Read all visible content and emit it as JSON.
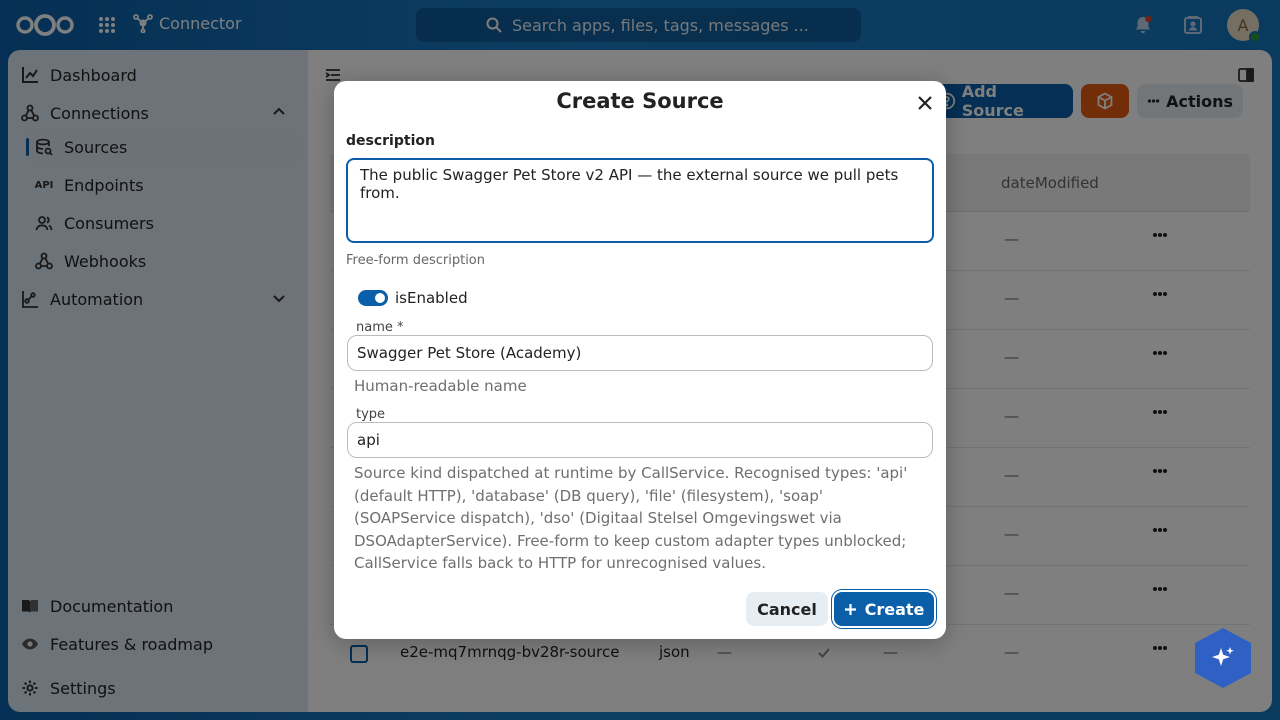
{
  "header": {
    "app_name": "Connector",
    "search_placeholder": "Search apps, files, tags, messages ...",
    "avatar_initial": "A"
  },
  "sidebar": {
    "items": [
      {
        "label": "Dashboard",
        "icon": "dashboard-icon"
      },
      {
        "label": "Connections",
        "icon": "connections-icon"
      },
      {
        "label": "Sources",
        "icon": "sources-icon"
      },
      {
        "label": "Endpoints",
        "icon": "api-icon"
      },
      {
        "label": "Consumers",
        "icon": "consumers-icon"
      },
      {
        "label": "Webhooks",
        "icon": "webhooks-icon"
      },
      {
        "label": "Automation",
        "icon": "automation-icon"
      }
    ],
    "footer": [
      {
        "label": "Documentation",
        "icon": "book-icon"
      },
      {
        "label": "Features & roadmap",
        "icon": "eye-icon"
      },
      {
        "label": "Settings",
        "icon": "gear-icon"
      }
    ]
  },
  "main": {
    "add_source_label": "Add Source",
    "actions_label": "Actions",
    "columns": {
      "date_modified": "dateModified"
    },
    "empty_value": "—",
    "last_row": {
      "name": "e2e-mq7mrnqg-bv28r-source",
      "type": "json"
    }
  },
  "dialog": {
    "title": "Create Source",
    "description_label": "description",
    "description_value": "The public Swagger Pet Store v2 API — the external source we pull pets from.",
    "description_hint": "Free-form description",
    "enabled_label": "isEnabled",
    "name_label": "name *",
    "name_value": "Swagger Pet Store (Academy)",
    "name_hint": "Human-readable name",
    "type_label": "type",
    "type_value": "api",
    "type_hint": "Source kind dispatched at runtime by CallService. Recognised types: 'api' (default HTTP), 'database' (DB query), 'file' (filesystem), 'soap' (SOAPService dispatch), 'dso' (Digitaal Stelsel Omgevingswet via DSOAdapterService). Free-form to keep custom adapter types unblocked; CallService falls back to HTTP for unrecognised values.",
    "cancel_label": "Cancel",
    "create_label": "Create"
  },
  "colors": {
    "primary": "#0b5fa8",
    "accent_orange": "#e25c12",
    "assistant": "#2f61c4"
  }
}
